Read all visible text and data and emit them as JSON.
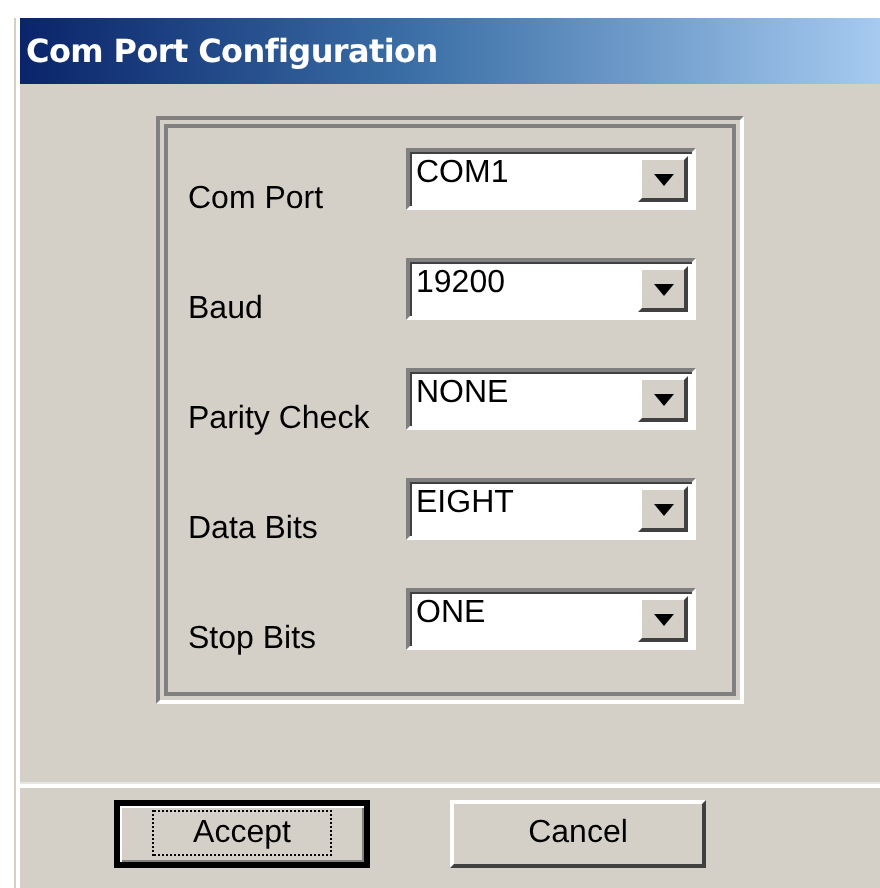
{
  "window": {
    "title": "Com Port Configuration"
  },
  "fields": [
    {
      "label": "Com Port",
      "value": "COM1"
    },
    {
      "label": "Baud",
      "value": "19200"
    },
    {
      "label": "Parity Check",
      "value": "NONE"
    },
    {
      "label": "Data Bits",
      "value": "EIGHT"
    },
    {
      "label": "Stop Bits",
      "value": "ONE"
    }
  ],
  "buttons": [
    {
      "label": "Accept",
      "focused": true
    },
    {
      "label": "Cancel",
      "focused": false
    }
  ]
}
